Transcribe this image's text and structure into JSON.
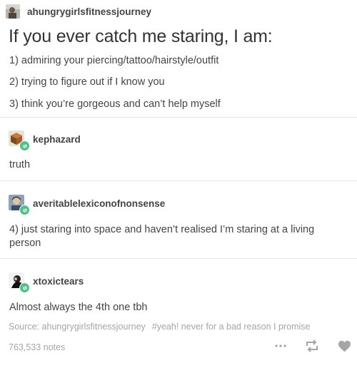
{
  "post": {
    "author": "ahungrygirlsfitnessjourney",
    "title": "If you ever catch me staring, I am:",
    "items": [
      "1) admiring your piercing/tattoo/hairstyle/outfit",
      "2) trying to figure out if I know you",
      "3) think you’re gorgeous and can’t help myself"
    ]
  },
  "reblogs": [
    {
      "username": "kephazard",
      "text": "truth"
    },
    {
      "username": "averitablelexiconofnonsense",
      "text": "4) just staring into space and haven’t realised I’m staring at a living person"
    },
    {
      "username": "xtoxictears",
      "text": "Almost always the 4th one tbh"
    }
  ],
  "footer": {
    "source": "Source: ahungrygirlsfitnessjourney",
    "tags": "#yeah! never for a bad reason I promise",
    "notes": "763,533 notes"
  },
  "icons": {
    "author_avatar": "person-avatar",
    "reblog_badge": "reblog-icon",
    "more": "more-options-icon",
    "reblog": "reblog-icon",
    "like": "heart-icon"
  },
  "colors": {
    "reblog_green": "#56bc8a",
    "meta_gray": "#a5a5a5",
    "text": "#444444"
  }
}
